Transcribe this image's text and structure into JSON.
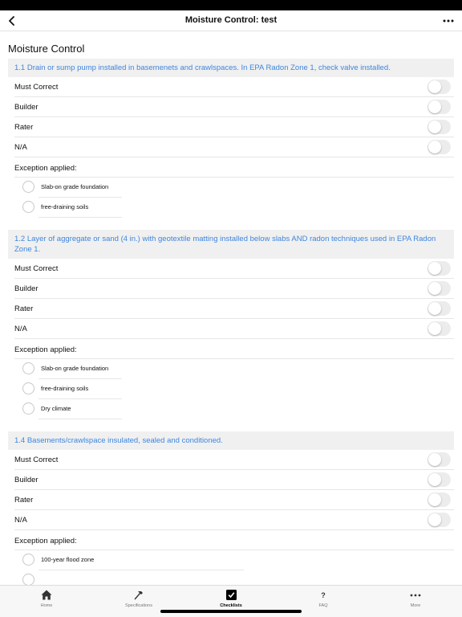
{
  "nav": {
    "title": "Moisture Control: test"
  },
  "page": {
    "heading": "Moisture Control"
  },
  "colors": {
    "link_blue": "#3f86dd",
    "header_bg": "#f0f0f0"
  },
  "sections": [
    {
      "title": "1.1 Drain or sump pump installed in basemenets and crawlspaces. In EPA Radon Zone 1, check valve installed.",
      "toggles": [
        {
          "label": "Must Correct",
          "on": false
        },
        {
          "label": "Builder",
          "on": false
        },
        {
          "label": "Rater",
          "on": false
        },
        {
          "label": "N/A",
          "on": false
        }
      ],
      "exception_label": "Exception applied:",
      "exceptions": [
        "Slab-on grade foundation",
        "free-draining soils"
      ]
    },
    {
      "title": "1.2 Layer of aggregate or sand (4 in.) with geotextile matting installed below slabs AND radon techniques used in EPA Radon Zone 1.",
      "toggles": [
        {
          "label": "Must Correct",
          "on": false
        },
        {
          "label": "Builder",
          "on": false
        },
        {
          "label": "Rater",
          "on": false
        },
        {
          "label": "N/A",
          "on": false
        }
      ],
      "exception_label": "Exception applied:",
      "exceptions": [
        "Slab-on grade foundation",
        "free-draining soils",
        "Dry climate"
      ]
    },
    {
      "title": "1.4 Basements/crawlspace insulated, sealed and conditioned.",
      "toggles": [
        {
          "label": "Must Correct",
          "on": false
        },
        {
          "label": "Builder",
          "on": false
        },
        {
          "label": "Rater",
          "on": false
        },
        {
          "label": "N/A",
          "on": false
        }
      ],
      "exception_label": "Exception applied:",
      "exceptions": [
        "100-year flood zone"
      ]
    }
  ],
  "tabs": [
    {
      "label": "Home",
      "icon": "home-icon",
      "active": false
    },
    {
      "label": "Specifications",
      "icon": "hammer-icon",
      "active": false
    },
    {
      "label": "Checklists",
      "icon": "checkbox-icon",
      "active": true
    },
    {
      "label": "FAQ",
      "icon": "question-icon",
      "active": false
    },
    {
      "label": "More",
      "icon": "more-icon",
      "active": false
    }
  ]
}
